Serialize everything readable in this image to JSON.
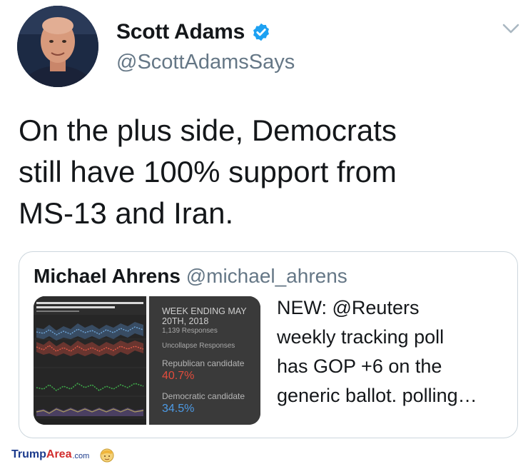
{
  "author": {
    "name": "Scott Adams",
    "handle": "@ScottAdamsSays",
    "verified": true,
    "accent_color": "#1da1f2"
  },
  "icons": {
    "verified": "verified-badge-icon",
    "menu": "chevron-down-icon",
    "avatar": "profile-photo"
  },
  "tweet": {
    "lines": [
      "On the plus side, Democrats",
      "still have 100% support from",
      "MS-13 and Iran."
    ]
  },
  "quoted_tweet": {
    "name": "Michael Ahrens",
    "handle": "@michael_ahrens",
    "lines": [
      "NEW: @Reuters",
      "weekly tracking poll",
      "has GOP +6 on the",
      "generic ballot. polling…"
    ],
    "media": {
      "week": [
        "WEEK ENDING MAY",
        "20TH, 2018"
      ],
      "responses": "1,139 Responses",
      "uncollapse": "Uncollapse Responses",
      "rep_label": "Republican candidate",
      "rep_value": "40.7%",
      "dem_label": "Democratic candidate",
      "dem_value": "34.5%",
      "rep_color": "#e34c3c",
      "dem_color": "#4d9be6"
    }
  },
  "watermark": {
    "brand_part1": "Trump",
    "brand_part2": "Area",
    "brand_suffix": ".com"
  }
}
